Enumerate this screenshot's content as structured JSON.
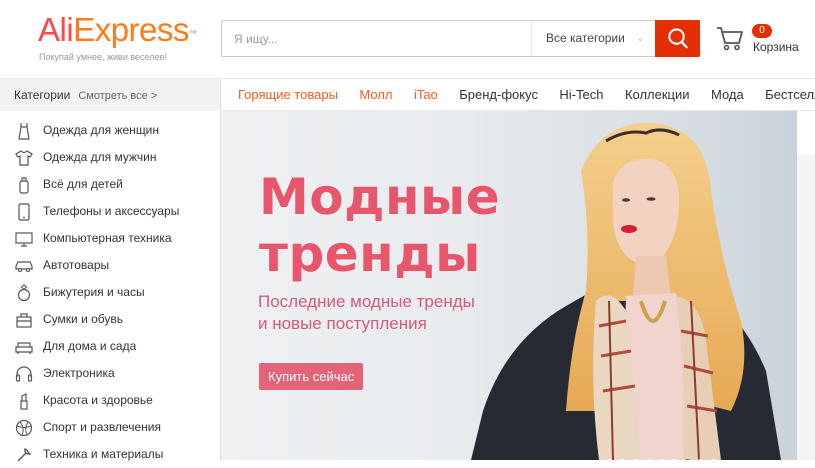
{
  "header": {
    "logo_part1": "Ali",
    "logo_part2": "Express",
    "logo_tm": "™",
    "tagline": "Покупай умнее, живи веселее!",
    "search_placeholder": "Я ищу...",
    "category_select": "Все категории",
    "cart_count": "0",
    "cart_label": "Корзина"
  },
  "nav": {
    "categories_label": "Категории",
    "see_all": "Смотреть все >",
    "links": [
      "Горящие товары",
      "Молл",
      "iTao",
      "Бренд-фокус",
      "Hi-Tech",
      "Коллекции",
      "Мода",
      "Бестселлер"
    ]
  },
  "sidebar": {
    "items": [
      {
        "label": "Одежда для женщин",
        "icon": "dress-icon"
      },
      {
        "label": "Одежда для мужчин",
        "icon": "shirt-icon"
      },
      {
        "label": "Всё для детей",
        "icon": "baby-bottle-icon"
      },
      {
        "label": "Телефоны и аксессуары",
        "icon": "phone-icon"
      },
      {
        "label": "Компьютерная техника",
        "icon": "computer-icon"
      },
      {
        "label": "Автотовары",
        "icon": "car-icon"
      },
      {
        "label": "Бижутерия и часы",
        "icon": "ring-icon"
      },
      {
        "label": "Сумки и обувь",
        "icon": "bag-icon"
      },
      {
        "label": "Для дома и сада",
        "icon": "sofa-icon"
      },
      {
        "label": "Электроника",
        "icon": "headphones-icon"
      },
      {
        "label": "Красота и здоровье",
        "icon": "lipstick-icon"
      },
      {
        "label": "Спорт и развлечения",
        "icon": "ball-icon"
      },
      {
        "label": "Техника и материалы",
        "icon": "tools-icon"
      }
    ]
  },
  "banner": {
    "title_line1": "Модные",
    "title_line2": "тренды",
    "subtitle_line1": "Последние модные тренды",
    "subtitle_line2": "и новые поступления",
    "button": "Купить сейчас",
    "slides_total": 9,
    "active_slide": 6
  },
  "colors": {
    "accent": "#e62e04",
    "nav_hot": "#ff5a1f",
    "banner_title": "#e8566b",
    "banner_button": "#e36478"
  }
}
